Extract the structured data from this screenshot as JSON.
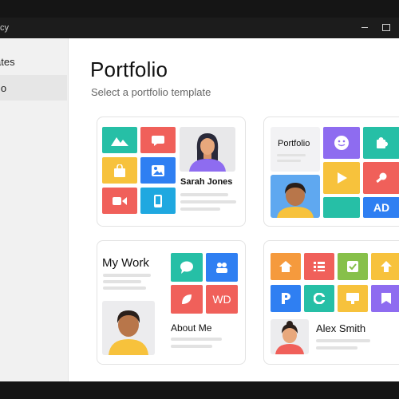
{
  "window": {
    "title_fragment": "cy"
  },
  "sidebar": {
    "section_title": "ates",
    "items": [
      {
        "label": "lo"
      }
    ]
  },
  "main": {
    "title": "Portfolio",
    "subtitle": "Select a portfolio template"
  },
  "templates": [
    {
      "name": "Sarah Jones"
    },
    {
      "heading": "Portfolio",
      "tile_text": "AD"
    },
    {
      "heading": "My Work",
      "caption": "About Me",
      "tile_text": "WD"
    },
    {
      "name": "Alex Smith"
    }
  ],
  "colors": {
    "teal": "#26bfa6",
    "red": "#f0605a",
    "yellow": "#f7c23c",
    "blue": "#2f7ff2",
    "purple": "#8e6cf0",
    "green": "#87c04a",
    "orange": "#f59a3d",
    "cyan": "#1fa8e0"
  }
}
